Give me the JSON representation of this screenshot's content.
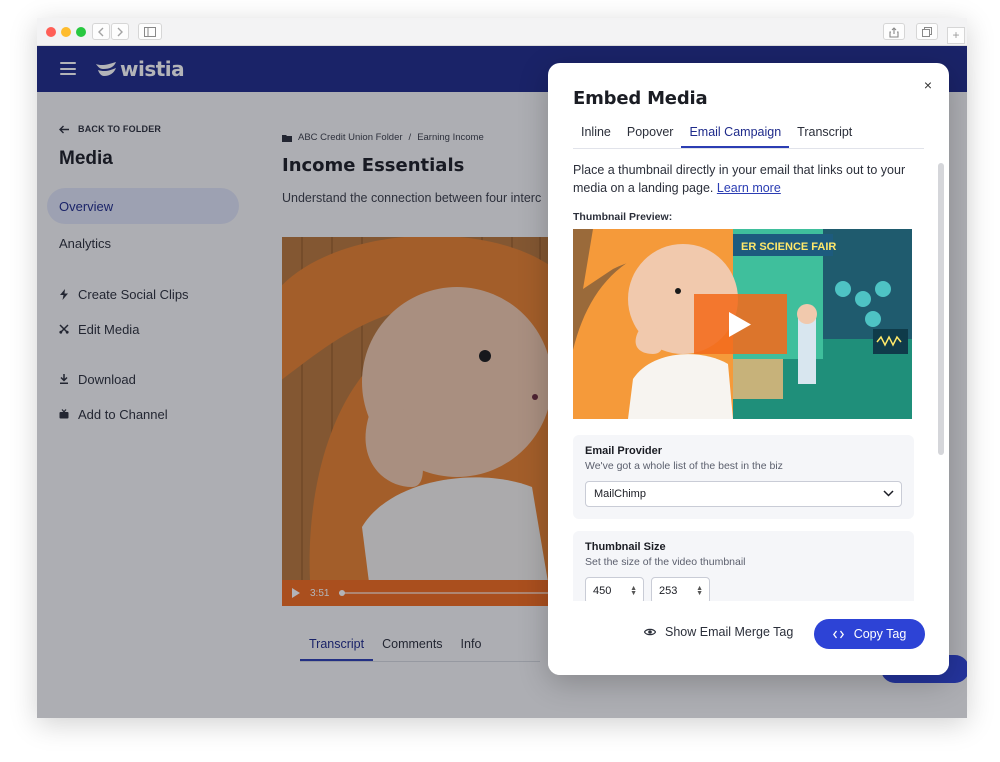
{
  "browser": {
    "back_icon": "chevron-left-icon",
    "forward_icon": "chevron-right-icon",
    "sidebar_icon": "sidebar-icon",
    "share_icon": "share-icon",
    "tabs_icon": "tabs-icon",
    "newtab_label": "+"
  },
  "header": {
    "logo_text": "wistia",
    "brand_color": "#1e2a8a"
  },
  "sidebar": {
    "back_label": "BACK TO FOLDER",
    "title": "Media",
    "items": [
      {
        "label": "Overview",
        "icon": "",
        "active": true
      },
      {
        "label": "Analytics",
        "icon": ""
      },
      {
        "label": "Create Social Clips",
        "icon": "lightning-icon"
      },
      {
        "label": "Edit Media",
        "icon": "scissors-icon"
      },
      {
        "label": "Download",
        "icon": "download-icon"
      },
      {
        "label": "Add to Channel",
        "icon": "channel-icon"
      }
    ]
  },
  "main": {
    "breadcrumb": [
      "ABC Credit Union Folder",
      "/",
      "Earning Income"
    ],
    "title": "Income Essentials",
    "description": "Understand the connection between four interc",
    "video": {
      "time": "3:51",
      "progress": 0.0
    },
    "tabs": [
      {
        "label": "Transcript",
        "active": true
      },
      {
        "label": "Comments"
      },
      {
        "label": "Info"
      }
    ]
  },
  "modal": {
    "title": "Embed Media",
    "close_label": "×",
    "tabs": [
      {
        "label": "Inline"
      },
      {
        "label": "Popover"
      },
      {
        "label": "Email Campaign",
        "active": true
      },
      {
        "label": "Transcript"
      }
    ],
    "intro_text": "Place a thumbnail directly in your email that links out to your media on a landing page.",
    "learn_more": "Learn more",
    "thumbnail_label": "Thumbnail Preview:",
    "thumbnail_sign": "ER SCIENCE FAIR",
    "email_provider": {
      "title": "Email Provider",
      "subtitle": "We've got a whole list of the best in the biz",
      "selected": "MailChimp"
    },
    "thumbnail_size": {
      "title": "Thumbnail Size",
      "subtitle": "Set the size of the video thumbnail",
      "width": "450",
      "height": "253"
    },
    "show_merge_label": "Show Email Merge Tag",
    "copy_label": "Copy Tag",
    "accent_color": "#2d43d6"
  }
}
